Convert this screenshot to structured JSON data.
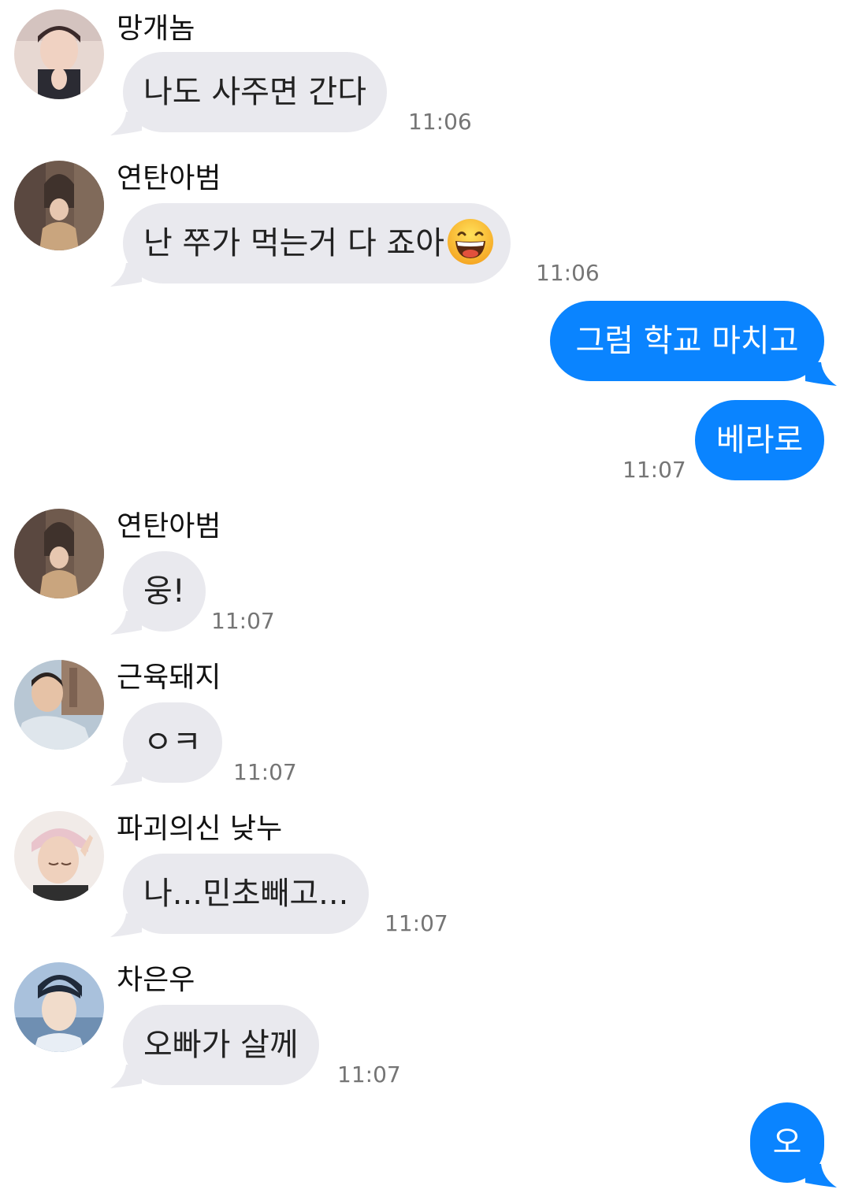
{
  "colors": {
    "incoming_bubble": "#e9e9ee",
    "outgoing_bubble": "#0a84ff",
    "timestamp": "#757575"
  },
  "messages": [
    {
      "sender": "망개놈",
      "text": "나도 사주면 간다",
      "time": "11:06",
      "avatar_icon": "profile-photo"
    },
    {
      "sender": "연탄아범",
      "text": "난 쭈가 먹는거 다 죠아",
      "emoji": "grinning-face-emoji",
      "time": "11:06",
      "avatar_icon": "profile-photo"
    },
    {
      "text": "그럼 학교 마치고"
    },
    {
      "text": "베라로",
      "time": "11:07"
    },
    {
      "sender": "연탄아범",
      "text": "웅!",
      "time": "11:07",
      "avatar_icon": "profile-photo"
    },
    {
      "sender": "근육돼지",
      "text": "ㅇㅋ",
      "time": "11:07",
      "avatar_icon": "profile-photo"
    },
    {
      "sender": "파괴의신 낮누",
      "text": "나...민초빼고...",
      "time": "11:07",
      "avatar_icon": "profile-photo"
    },
    {
      "sender": "차은우",
      "text": "오빠가 살께",
      "time": "11:07",
      "avatar_icon": "profile-photo"
    },
    {
      "text": "오"
    }
  ]
}
